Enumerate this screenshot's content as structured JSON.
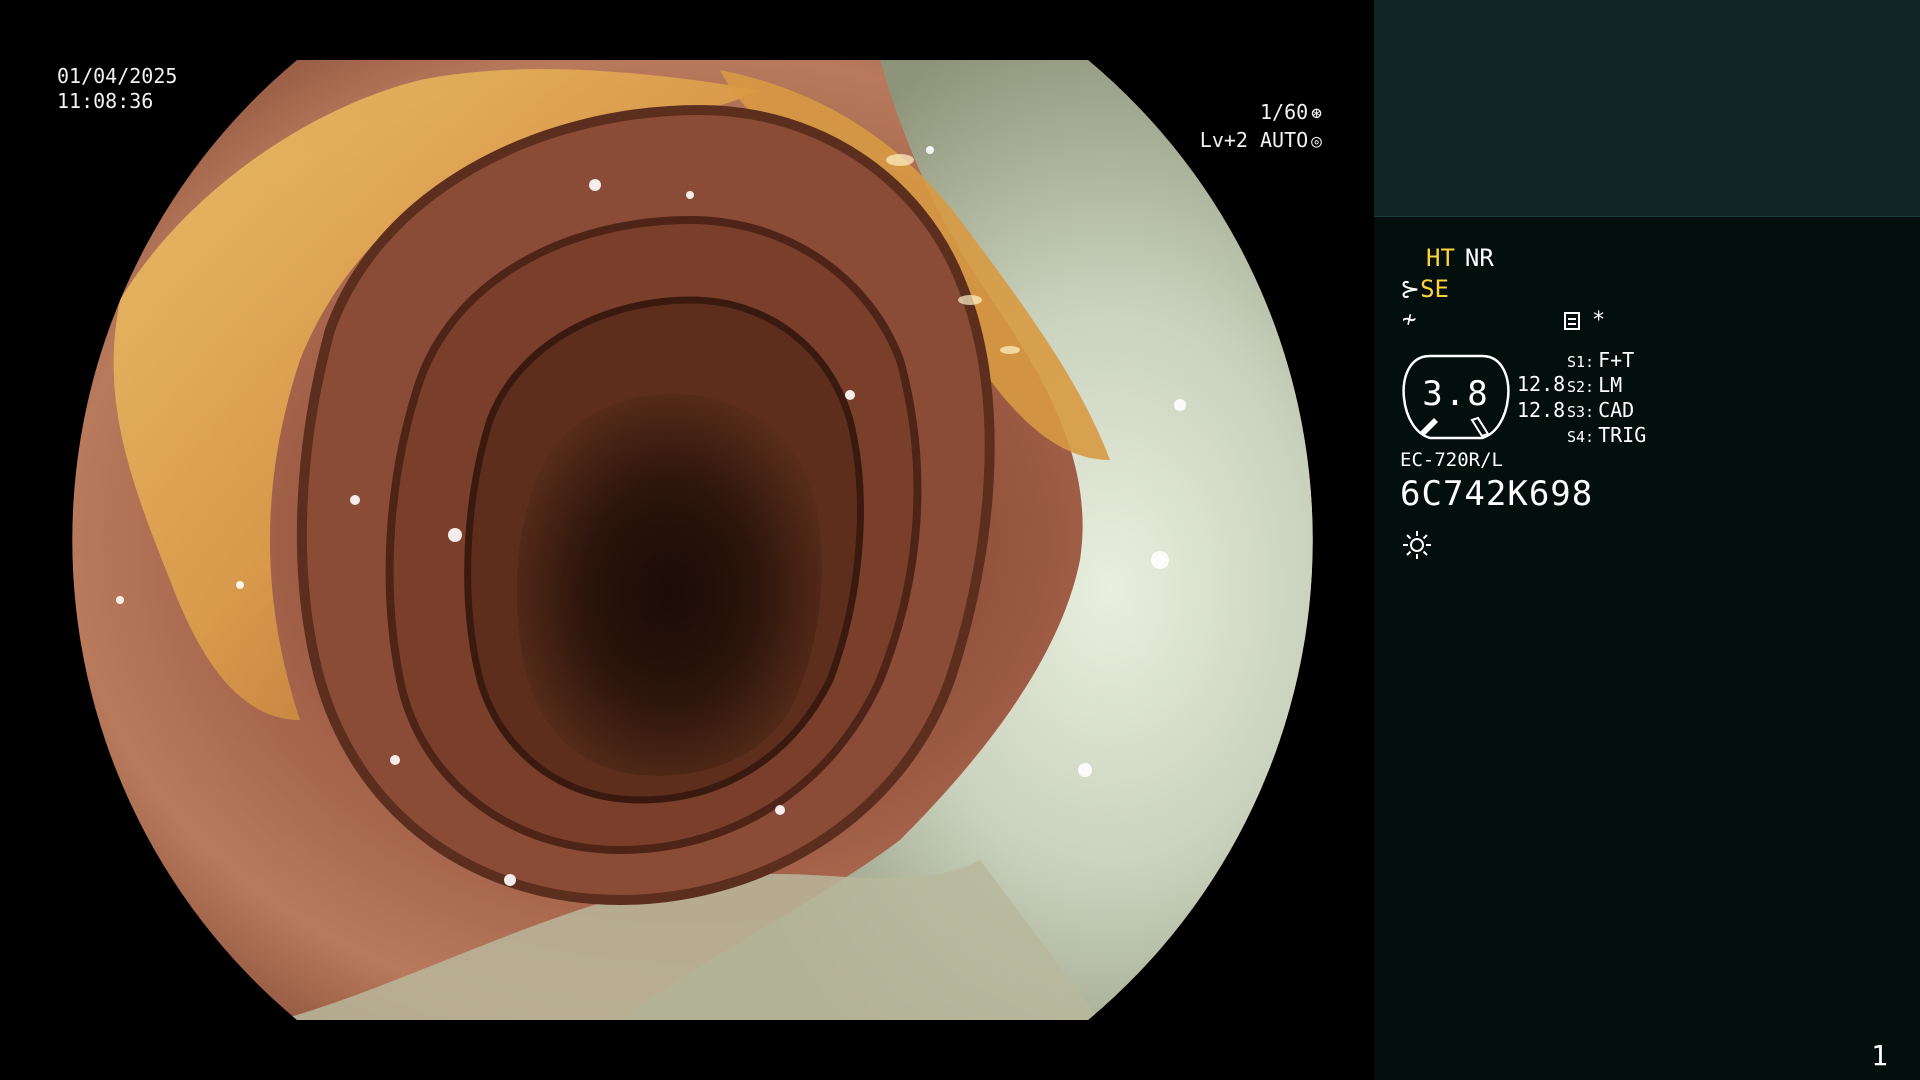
{
  "overlay": {
    "date": "01/04/2025",
    "time": "11:08:36",
    "shutter": "1/60",
    "shutter_icon": "shutter-icon",
    "exposure": "Lv+2 AUTO",
    "exposure_icon": "iris-icon"
  },
  "panel": {
    "ht": "HT",
    "nr": "NR",
    "se_icon": "scope-bend-icon",
    "se": "SE",
    "f_icon": "freeze-icon",
    "menu_icon": "memo-icon",
    "star": "*",
    "gauge": {
      "value": "3.8",
      "sub1": "12.8",
      "sub2": "12.8"
    },
    "switches": [
      {
        "key": "S1:",
        "value": "F+T"
      },
      {
        "key": "S2:",
        "value": "LM"
      },
      {
        "key": "S3:",
        "value": "CAD"
      },
      {
        "key": "S4:",
        "value": "TRIG"
      }
    ],
    "model": "EC-720R/L",
    "serial": "6C742K698",
    "light_icon": "light-icon",
    "frame": "1"
  },
  "colors": {
    "panel_bg": "#030f0d",
    "thumb_bg": "#0f2625",
    "accent_yellow": "#ffd23a",
    "text": "#ffffff"
  }
}
